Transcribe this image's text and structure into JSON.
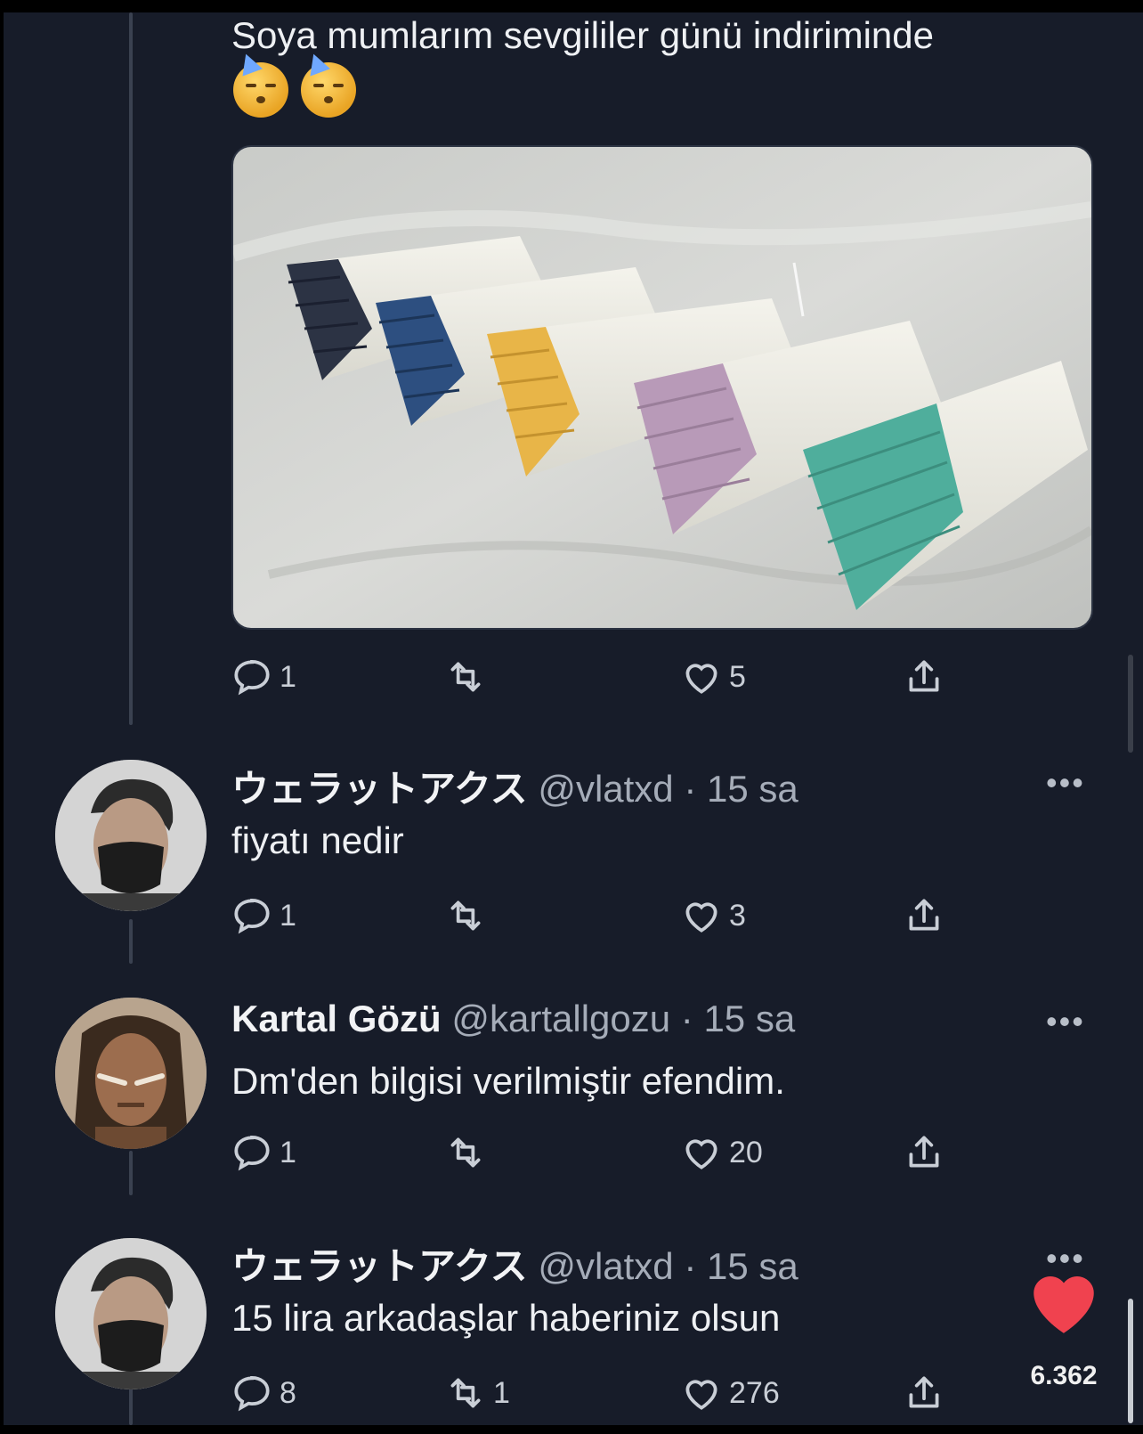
{
  "post": {
    "text": "Soya mumlarım sevgililer günü indiriminde",
    "emojis": [
      "partying-face-emoji",
      "partying-face-emoji"
    ],
    "actions": {
      "reply": "1",
      "retweet": "",
      "like": "5"
    }
  },
  "replies": [
    {
      "name": "ウェラットアクス",
      "handle": "@vlatxd",
      "time": "· 15 sa",
      "text": "fiyatı nedir",
      "actions": {
        "reply": "1",
        "retweet": "",
        "like": "3"
      }
    },
    {
      "name": "Kartal Gözü",
      "handle": "@kartallgozu",
      "time": "· 15 sa",
      "text": "Dm'den bilgisi verilmiştir efendim.",
      "actions": {
        "reply": "1",
        "retweet": "",
        "like": "20"
      }
    },
    {
      "name": "ウェラットアクス",
      "handle": "@vlatxd",
      "time": "· 15 sa",
      "text": "15 lira arkadaşlar haberiniz olsun",
      "actions": {
        "reply": "8",
        "retweet": "1",
        "like": "276"
      }
    }
  ],
  "more_label": "•••",
  "overlay": {
    "like_count": "6.362"
  },
  "colors": {
    "background": "#171c29",
    "like_heart": "#f0424f",
    "candles": [
      "#2c3344",
      "#2d4f80",
      "#e8b548",
      "#b89ab8",
      "#4fae9c"
    ]
  }
}
